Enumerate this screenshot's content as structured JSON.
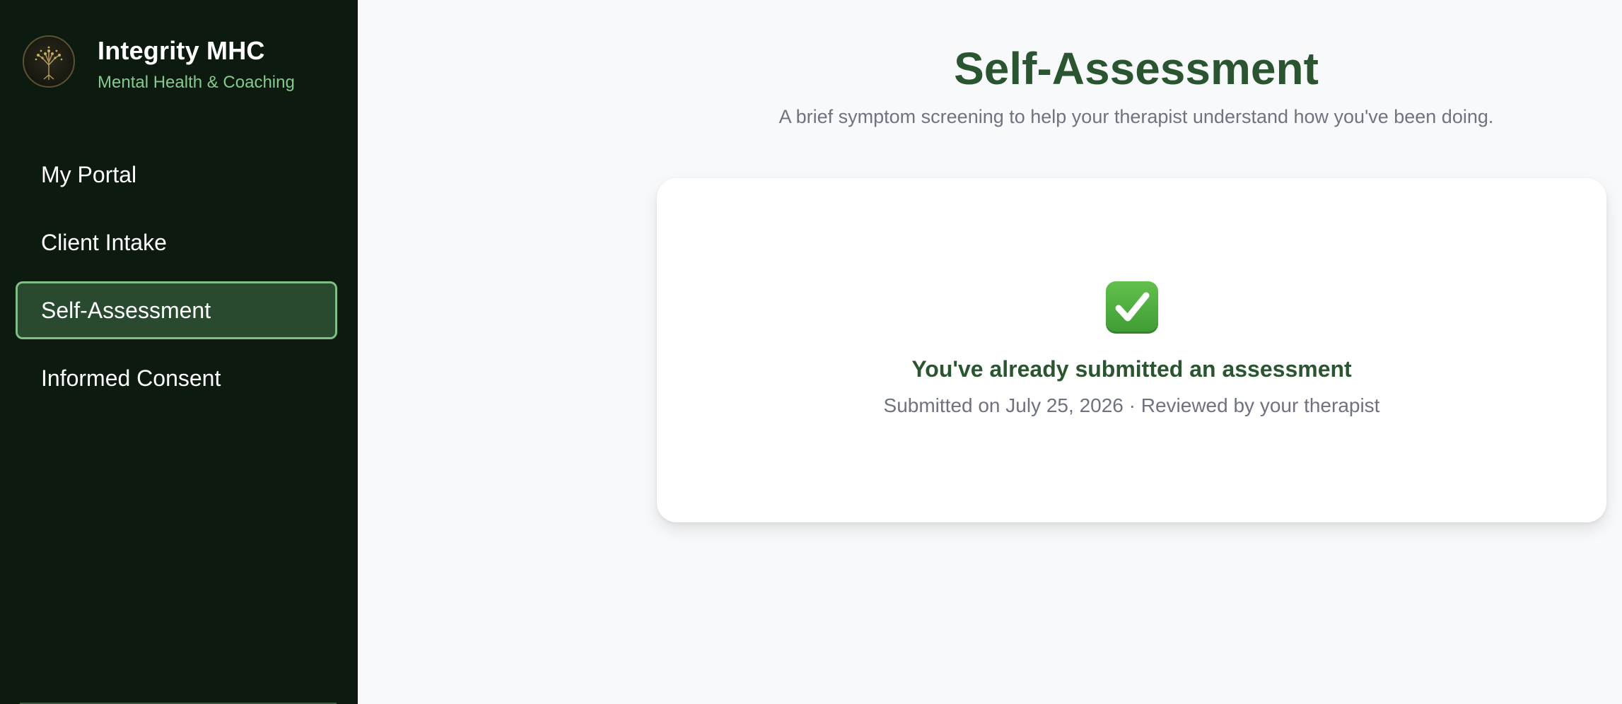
{
  "sidebar": {
    "brand_title": "Integrity MHC",
    "brand_subtitle": "Mental Health & Coaching",
    "logo_icon": "tree-of-life-icon",
    "items": [
      {
        "label": "My Portal",
        "active": false
      },
      {
        "label": "Client Intake",
        "active": false
      },
      {
        "label": "Self-Assessment",
        "active": true
      },
      {
        "label": "Informed Consent",
        "active": false
      }
    ]
  },
  "main": {
    "title": "Self-Assessment",
    "subtitle": "A brief symptom screening to help your therapist understand how you've been doing.",
    "status_card": {
      "icon": "check-mark-button-icon",
      "heading": "You've already submitted an assessment",
      "meta": "Submitted on July 25, 2026 · Reviewed by your therapist"
    }
  },
  "colors": {
    "sidebar_bg": "#0c1a0f",
    "accent_green": "#2b5530",
    "active_item_bg": "#2a4a2f",
    "active_item_border": "#7fbf86",
    "subtitle_green": "#86c98e",
    "check_green": "#4eae3e"
  }
}
